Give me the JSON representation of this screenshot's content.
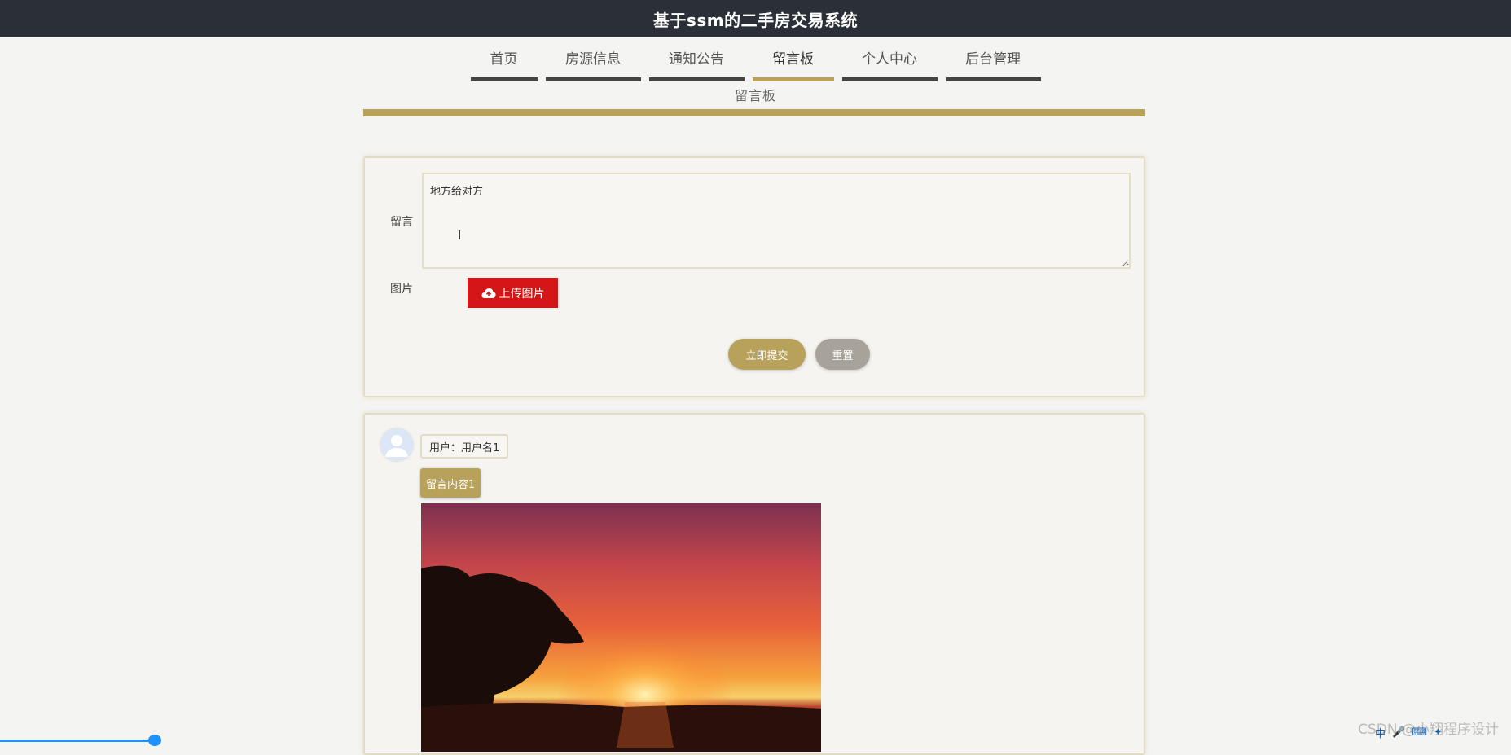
{
  "header": {
    "title": "基于ssm的二手房交易系统"
  },
  "nav": {
    "items": [
      {
        "label": "首页",
        "active": false
      },
      {
        "label": "房源信息",
        "active": false
      },
      {
        "label": "通知公告",
        "active": false
      },
      {
        "label": "留言板",
        "active": true
      },
      {
        "label": "个人中心",
        "active": false
      },
      {
        "label": "后台管理",
        "active": false
      }
    ]
  },
  "page": {
    "subtitle": "留言板"
  },
  "form": {
    "message_label": "留言",
    "message_value": "地方给对方",
    "image_label": "图片",
    "upload_label": "上传图片",
    "submit_label": "立即提交",
    "reset_label": "重置"
  },
  "messages": [
    {
      "user": "用户：用户名1",
      "content": "留言内容1",
      "image_icon": "sunset-photo"
    }
  ],
  "watermark": "CSDN @小翔程序设计",
  "tray": {
    "ime": "中"
  },
  "colors": {
    "topbar": "#2b2f38",
    "accent": "#b8a15a",
    "upload": "#d41515",
    "reset": "#a7a39a"
  }
}
